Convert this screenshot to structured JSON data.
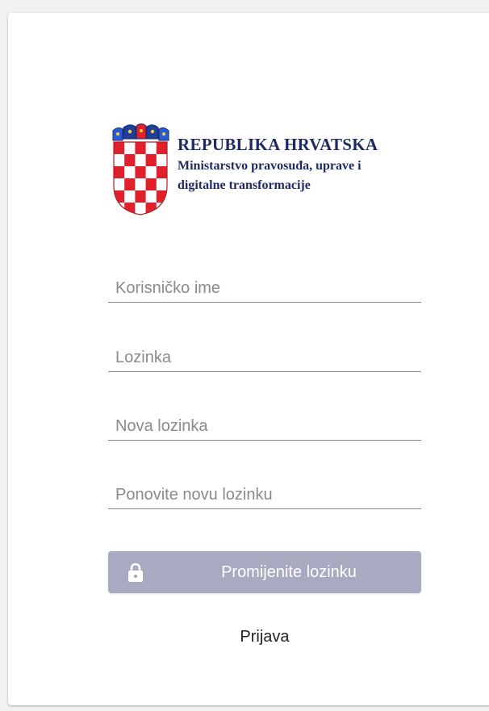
{
  "logo": {
    "title": "REPUBLIKA HRVATSKA",
    "subtitle_line1": "Ministarstvo pravosuđa, uprave i",
    "subtitle_line2": "digitalne transformacije",
    "icon": "croatian-coat-of-arms"
  },
  "form": {
    "username": {
      "placeholder": "Korisničko ime",
      "value": ""
    },
    "password": {
      "placeholder": "Lozinka",
      "value": ""
    },
    "new_password": {
      "placeholder": "Nova lozinka",
      "value": ""
    },
    "repeat_password": {
      "placeholder": "Ponovite novu lozinku",
      "value": ""
    },
    "submit_label": "Promijenite lozinku",
    "submit_icon": "lock-icon"
  },
  "login_link": "Prijava",
  "colors": {
    "brand_text": "#1f2a63",
    "button_bg": "#a7aac0",
    "crest_red": "#e0202a",
    "crest_blue": "#1f3f9a"
  }
}
